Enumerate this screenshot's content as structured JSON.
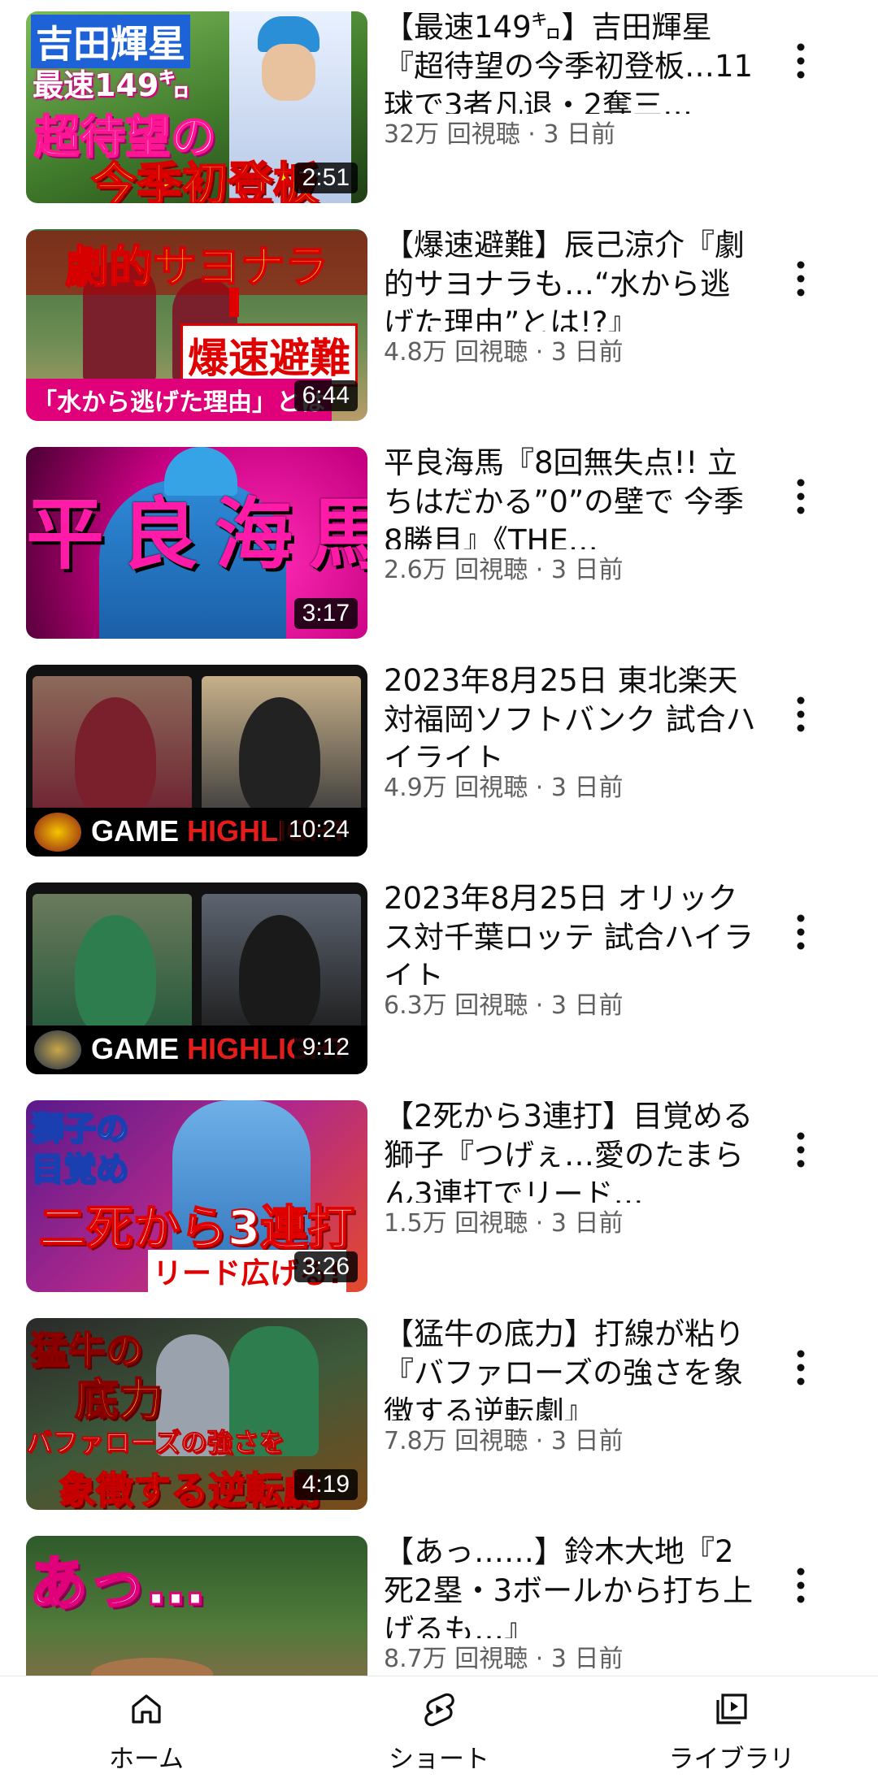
{
  "videos": [
    {
      "title": "【最速149㌔】吉田輝星『超待望の今季初登板…11球で3者凡退・2奪三…",
      "meta": "32万 回視聴 · 3 日前",
      "duration": "2:51",
      "thumb_text": [
        "吉田輝星",
        "最速149㌔",
        "超待望の",
        "今季初登板"
      ]
    },
    {
      "title": "【爆速避難】辰己涼介『劇的サヨナラも…“水から逃げた理由”とは!?』",
      "meta": "4.8万 回視聴 · 3 日前",
      "duration": "6:44",
      "thumb_text": [
        "劇的サヨナラ",
        "爆速避難",
        "「水から逃げた理由」とは"
      ]
    },
    {
      "title": "平良海馬『8回無失点!! 立ちはだかる”0”の壁で 今季8勝目』《THE…",
      "meta": "2.6万 回視聴 · 3 日前",
      "duration": "3:17",
      "thumb_text": [
        "平良海馬"
      ]
    },
    {
      "title": "2023年8月25日 東北楽天対福岡ソフトバンク 試合ハイライト",
      "meta": "4.9万 回視聴 · 3 日前",
      "duration": "10:24",
      "thumb_text": [
        "GAME",
        "HIGHLIGHT"
      ]
    },
    {
      "title": "2023年8月25日 オリックス対千葉ロッテ 試合ハイライト",
      "meta": "6.3万 回視聴 · 3 日前",
      "duration": "9:12",
      "thumb_text": [
        "GAME",
        "HIGHLIGHT"
      ]
    },
    {
      "title": "【2死から3連打】目覚める獅子『つげぇ…愛のたまらん3連打でリード…",
      "meta": "1.5万 回視聴 · 3 日前",
      "duration": "3:26",
      "thumb_text": [
        "獅子の",
        "目覚め",
        "二死から3連打",
        "リード広げる!"
      ]
    },
    {
      "title": "【猛牛の底力】打線が粘り『バファローズの強さを象徴する逆転劇』",
      "meta": "7.8万 回視聴 · 3 日前",
      "duration": "4:19",
      "thumb_text": [
        "猛牛の",
        "底力",
        "バファローズの強さを",
        "象徴する逆転劇"
      ]
    },
    {
      "title": "【あっ……】鈴木大地『2死2塁・3ボールから打ち上げるも…』",
      "meta": "8.7万 回視聴 · 3 日前",
      "duration": "",
      "thumb_text": [
        "あっ…"
      ]
    }
  ],
  "nav": {
    "home": "ホーム",
    "shorts": "ショート",
    "library": "ライブラリ"
  },
  "colors": {
    "accent": "#ff0000",
    "meta": "#606060",
    "pink": "#ff1aa8"
  }
}
